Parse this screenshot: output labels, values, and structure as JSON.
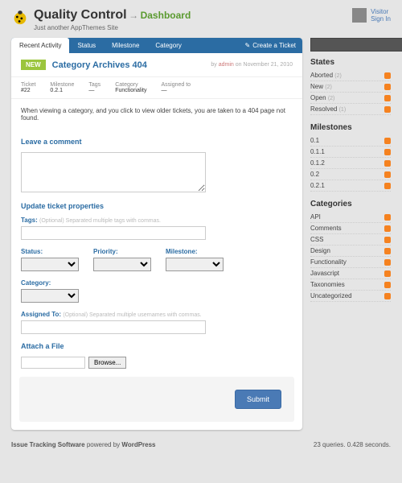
{
  "header": {
    "title": "Quality Control",
    "arrow": "→",
    "dashboard": "Dashboard",
    "tagline": "Just another AppThemes Site",
    "visitor": "Visitor",
    "signin": "Sign In"
  },
  "tabs": [
    "Recent Activity",
    "Status",
    "Milestone",
    "Category"
  ],
  "create_ticket": "Create a Ticket",
  "ticket": {
    "badge": "NEW",
    "title": "Category Archives 404",
    "by": "by",
    "author": "admin",
    "on": "on November 21, 2010",
    "meta": {
      "ticket_label": "Ticket",
      "ticket_val": "#22",
      "milestone_label": "Milestone",
      "milestone_val": "0.2.1",
      "tags_label": "Tags",
      "tags_val": "—",
      "category_label": "Category",
      "category_val": "Functionality",
      "assigned_label": "Assigned to",
      "assigned_val": "—"
    },
    "body": "When viewing a category, and you click to view older tickets, you are taken to a 404 page not found."
  },
  "comment_heading": "Leave a comment",
  "update_heading": "Update ticket properties",
  "form": {
    "tags_label": "Tags:",
    "tags_hint": "(Optional) Separated multiple tags with commas.",
    "status_label": "Status:",
    "priority_label": "Priority:",
    "milestone_label": "Milestone:",
    "category_label": "Category:",
    "assigned_label": "Assigned To:",
    "assigned_hint": "(Optional) Separated multiple usernames with commas."
  },
  "attach_heading": "Attach a File",
  "browse": "Browse...",
  "submit": "Submit",
  "sidebar": {
    "states_title": "States",
    "states": [
      {
        "label": "Aborted",
        "count": "(2)"
      },
      {
        "label": "New",
        "count": "(2)"
      },
      {
        "label": "Open",
        "count": "(2)"
      },
      {
        "label": "Resolved",
        "count": "(1)"
      }
    ],
    "milestones_title": "Milestones",
    "milestones": [
      "0.1",
      "0.1.1",
      "0.1.2",
      "0.2",
      "0.2.1"
    ],
    "categories_title": "Categories",
    "categories": [
      "API",
      "Comments",
      "CSS",
      "Design",
      "Functionality",
      "Javascript",
      "Taxonomies",
      "Uncategorized"
    ]
  },
  "footer": {
    "left1": "Issue Tracking Software",
    "left2": " powered by ",
    "left3": "WordPress",
    "right": "23 queries. 0.428 seconds."
  }
}
